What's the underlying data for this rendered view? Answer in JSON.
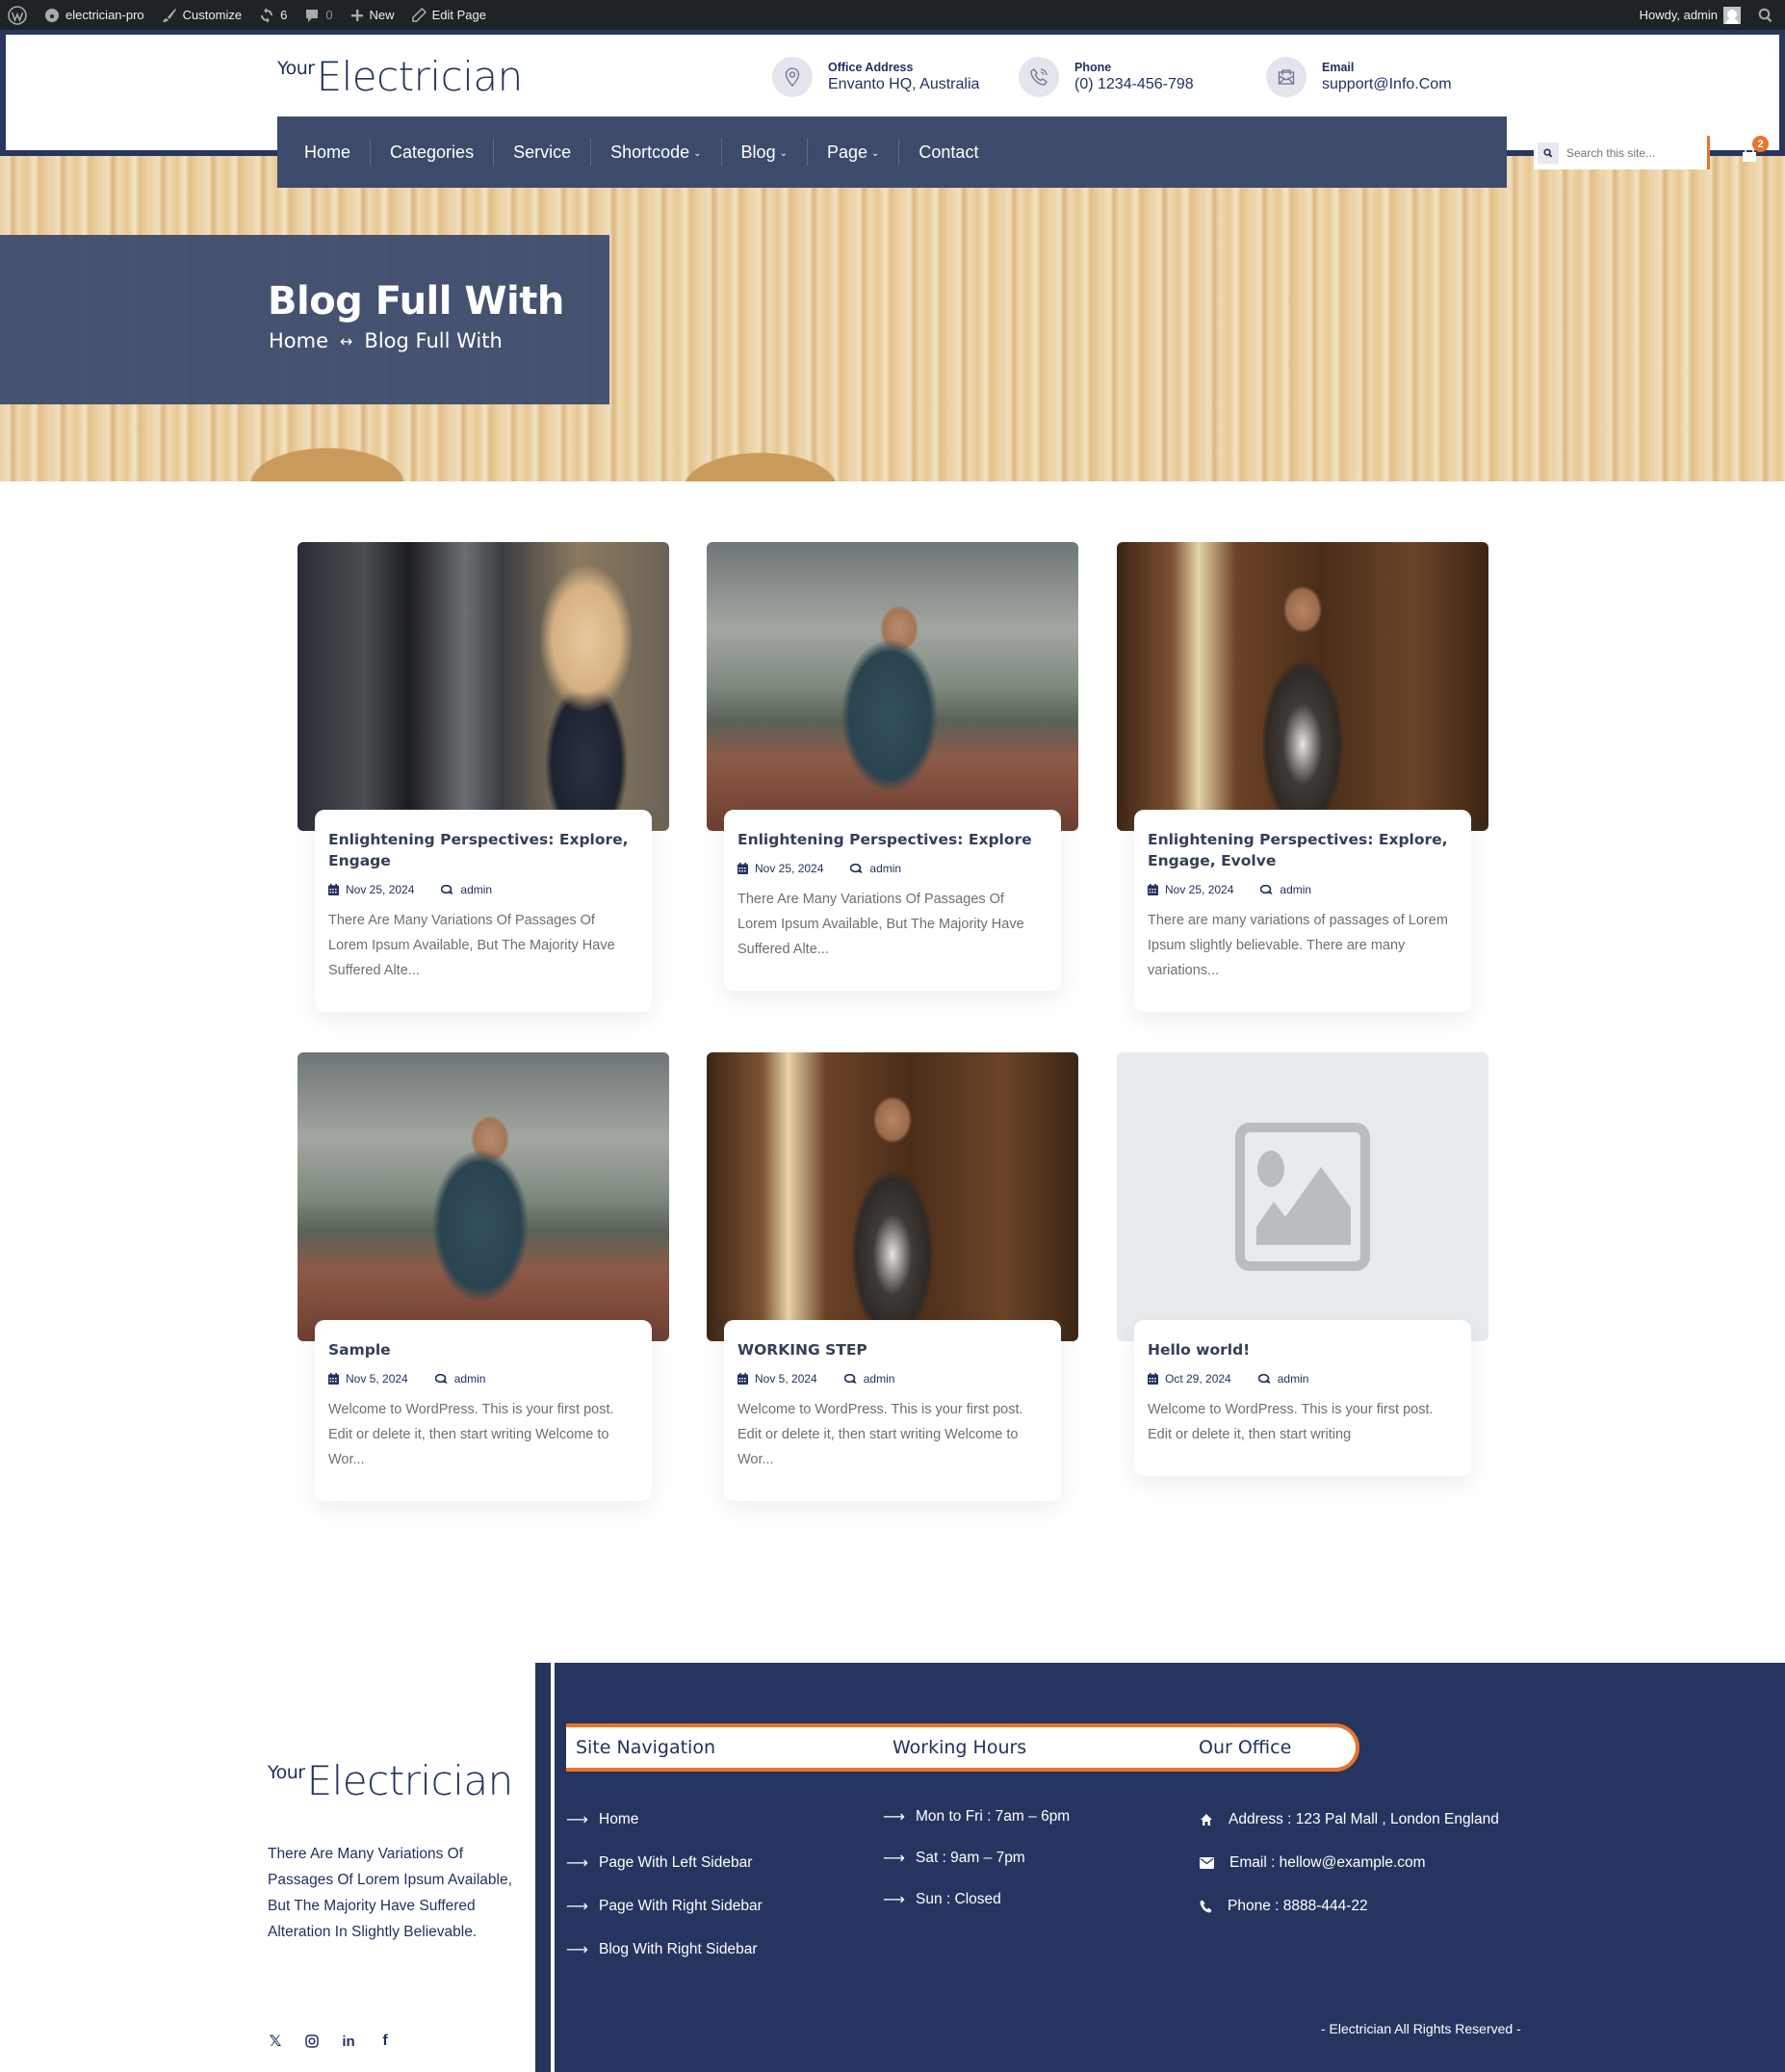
{
  "admin_bar": {
    "site_name": "electrician-pro",
    "customize": "Customize",
    "updates_count": "6",
    "comments_count": "0",
    "new_label": "New",
    "edit_page": "Edit Page",
    "howdy": "Howdy, admin"
  },
  "header": {
    "logo_small": "Your",
    "logo_large": "Electrician",
    "contacts": [
      {
        "label": "Office Address",
        "value": "Envanto HQ, Australia",
        "icon": "map-pin-icon"
      },
      {
        "label": "Phone",
        "value": "(0) 1234-456-798",
        "icon": "phone-icon"
      },
      {
        "label": "Email",
        "value": "support@Info.Com",
        "icon": "envelope-icon"
      }
    ]
  },
  "nav": {
    "items": [
      {
        "label": "Home",
        "has_dropdown": false
      },
      {
        "label": "Categories",
        "has_dropdown": false
      },
      {
        "label": "Service",
        "has_dropdown": false
      },
      {
        "label": "Shortcode",
        "has_dropdown": true
      },
      {
        "label": "Blog",
        "has_dropdown": true
      },
      {
        "label": "Page",
        "has_dropdown": true
      },
      {
        "label": "Contact",
        "has_dropdown": false
      }
    ],
    "search_placeholder": "Search this site...",
    "cart_count": "2"
  },
  "hero": {
    "title": "Blog Full With",
    "breadcrumb": [
      "Home",
      "Blog Full With"
    ],
    "breadcrumb_sep": "↔"
  },
  "posts": [
    {
      "title": "Enlightening Perspectives: Explore, Engage",
      "date": "Nov 25, 2024",
      "author": "admin",
      "excerpt": "There Are Many Variations Of Passages Of Lorem Ipsum Available, But The Majority Have Suffered Alte...",
      "image": "woman-at-machine"
    },
    {
      "title": "Enlightening Perspectives: Explore",
      "date": "Nov 25, 2024",
      "author": "admin",
      "excerpt": "There Are Many Variations Of Passages Of Lorem Ipsum Available, But The Majority Have Suffered Alte...",
      "image": "roofer"
    },
    {
      "title": "Enlightening Perspectives: Explore, Engage, Evolve",
      "date": "Nov 25, 2024",
      "author": "admin",
      "excerpt": "There are many variations of passages of Lorem Ipsum slightly believable. There are many variations...",
      "image": "carpenter"
    },
    {
      "title": "Sample",
      "date": "Nov 5, 2024",
      "author": "admin",
      "excerpt": "Welcome to WordPress. This is your first post. Edit or delete it, then start writing Welcome to Wor...",
      "image": "roofer"
    },
    {
      "title": "WORKING STEP",
      "date": "Nov 5, 2024",
      "author": "admin",
      "excerpt": "Welcome to WordPress. This is your first post. Edit or delete it, then start writing Welcome to Wor...",
      "image": "carpenter"
    },
    {
      "title": "Hello world!",
      "date": "Oct 29, 2024",
      "author": "admin",
      "excerpt": "Welcome to WordPress. This is your first post. Edit or delete it, then start writing",
      "image": "placeholder"
    }
  ],
  "footer": {
    "logo_small": "Your",
    "logo_large": "Electrician",
    "about": "There Are Many Variations Of Passages Of Lorem Ipsum Available, But The Majority Have Suffered Alteration In Slightly Believable.",
    "socials": [
      "x",
      "instagram",
      "linkedin",
      "facebook"
    ],
    "headings": {
      "nav": "Site Navigation",
      "hours": "Working Hours",
      "office": "Our Office"
    },
    "nav_links": [
      "Home",
      "Page With Left Sidebar",
      "Page With Right Sidebar",
      "Blog With Right Sidebar"
    ],
    "hours": [
      "Mon to Fri : 7am – 6pm",
      "Sat : 9am – 7pm",
      "Sun : Closed"
    ],
    "office": [
      {
        "icon": "home-icon",
        "text": "Address : 123 Pal Mall , London England"
      },
      {
        "icon": "envelope-icon",
        "text": "Email : hellow@example.com"
      },
      {
        "icon": "phone-icon",
        "text": "Phone : 8888-444-22"
      }
    ],
    "copyright": "- Electrician All Rights Reserved -"
  },
  "colors": {
    "navy": "#263560",
    "nav_bg": "#3c4b6c",
    "accent_orange": "#e8752a",
    "text_dark": "#223160"
  }
}
